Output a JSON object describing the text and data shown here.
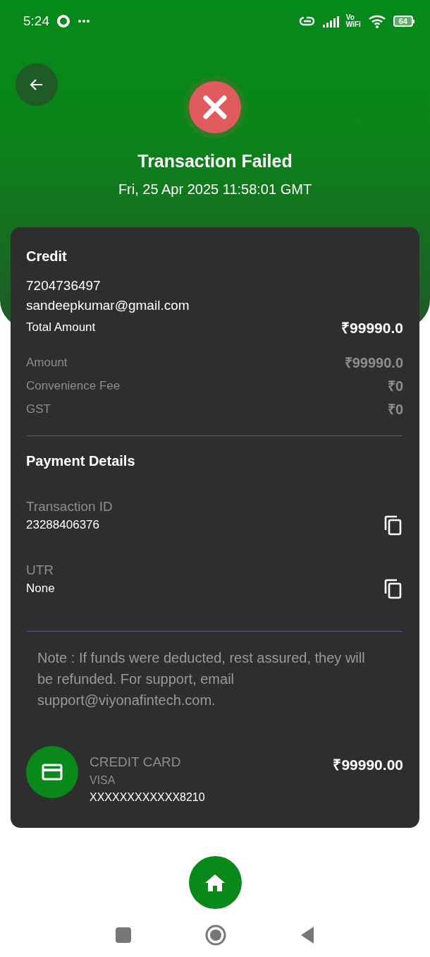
{
  "status_bar": {
    "time": "5:24",
    "network_label_top": "Vo",
    "network_label_bottom": "WiFi",
    "battery": "64"
  },
  "header": {
    "failed": true,
    "title": "Transaction Failed",
    "datetime": "Fri, 25 Apr 2025 11:58:01 GMT"
  },
  "summary": {
    "type": "Credit",
    "phone": "7204736497",
    "email": "sandeepkumar@gmail.com",
    "total_label": "Total Amount",
    "total_value": "₹99990.0",
    "breakdown": [
      {
        "label": "Amount",
        "value": "₹99990.0"
      },
      {
        "label": "Convenience Fee",
        "value": "₹0"
      },
      {
        "label": "GST",
        "value": "₹0"
      }
    ]
  },
  "payment_details": {
    "title": "Payment Details",
    "fields": [
      {
        "label": "Transaction ID",
        "value": "23288406376"
      },
      {
        "label": "UTR",
        "value": "None"
      }
    ]
  },
  "note": "Note : If funds were deducted, rest assured, they will be refunded. For support, email support@viyonafintech.com.",
  "payment_method": {
    "type": "CREDIT CARD",
    "network": "VISA",
    "number": "XXXXXXXXXXXX8210",
    "amount": "₹99990.00"
  }
}
